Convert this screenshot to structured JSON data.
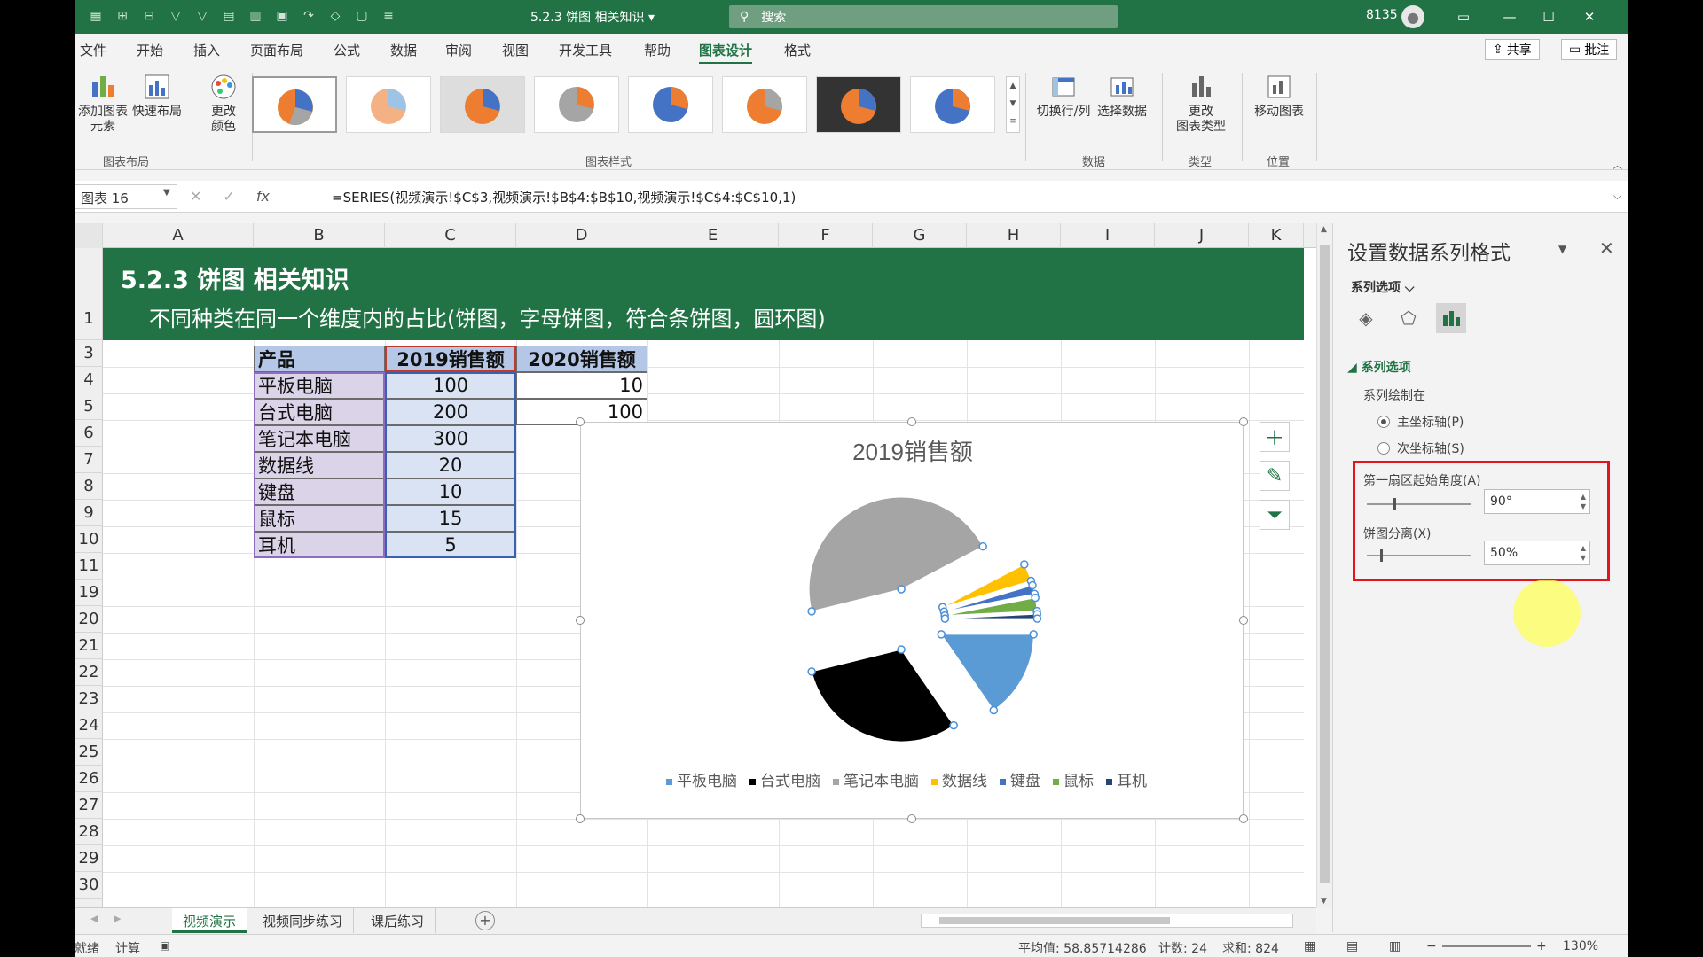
{
  "titlebar": {
    "doc_title": "5.2.3 饼图    相关知识 ▾",
    "search_placeholder": "搜索",
    "user_id": "8135",
    "minimize": "—",
    "restore": "☐",
    "close": "✕"
  },
  "menu": {
    "tabs": [
      "文件",
      "开始",
      "插入",
      "页面布局",
      "公式",
      "数据",
      "审阅",
      "视图",
      "开发工具",
      "帮助",
      "图表设计",
      "格式"
    ],
    "active": "图表设计",
    "share": "共享",
    "comment": "批注"
  },
  "ribbon": {
    "add_element": "添加图表\n元素",
    "quick_layout": "快速布局",
    "change_color": "更改\n颜色",
    "group_layout": "图表布局",
    "group_styles": "图表样式",
    "switch_row_col": "切换行/列",
    "select_data": "选择数据",
    "group_data": "数据",
    "change_type": "更改\n图表类型",
    "group_type": "类型",
    "move_chart": "移动图表",
    "group_location": "位置"
  },
  "formula_bar": {
    "name_box": "图表 16",
    "formula": "=SERIES(视频演示!$C$3,视频演示!$B$4:$B$10,视频演示!$C$4:$C$10,1)"
  },
  "columns": [
    "A",
    "B",
    "C",
    "D",
    "E",
    "F",
    "G",
    "H",
    "I",
    "J",
    "K"
  ],
  "rows": [
    "1",
    "3",
    "4",
    "5",
    "6",
    "7",
    "8",
    "9",
    "10",
    "11",
    "19",
    "20",
    "21",
    "22",
    "23",
    "24",
    "25",
    "26",
    "27",
    "28",
    "29",
    "30"
  ],
  "banner": {
    "title": "5.2.3 饼图  相关知识",
    "subtitle": "不同种类在同一个维度内的占比(饼图，字母饼图，符合条饼图，圆环图)"
  },
  "table": {
    "headers": [
      "产品",
      "2019销售额",
      "2020销售额"
    ],
    "rows": [
      [
        "平板电脑",
        "100",
        "10"
      ],
      [
        "台式电脑",
        "200",
        "100"
      ],
      [
        "笔记本电脑",
        "300",
        ""
      ],
      [
        "数据线",
        "20",
        ""
      ],
      [
        "键盘",
        "10",
        ""
      ],
      [
        "鼠标",
        "15",
        ""
      ],
      [
        "耳机",
        "5",
        ""
      ]
    ]
  },
  "chart_data": {
    "type": "pie",
    "title": "2019销售额",
    "categories": [
      "平板电脑",
      "台式电脑",
      "笔记本电脑",
      "数据线",
      "键盘",
      "鼠标",
      "耳机"
    ],
    "values": [
      100,
      200,
      300,
      20,
      10,
      15,
      5
    ],
    "colors": [
      "#5b9bd5",
      "#000000",
      "#a5a5a5",
      "#ffc000",
      "#4472c4",
      "#70ad47",
      "#264478"
    ],
    "first_slice_angle_deg": 90,
    "explosion_percent": 50,
    "legend_position": "bottom"
  },
  "format_pane": {
    "title": "设置数据系列格式",
    "series_options_dropdown": "系列选项 ⌵",
    "section": "系列选项",
    "plot_series_on": "系列绘制在",
    "primary_axis": "主坐标轴(P)",
    "secondary_axis": "次坐标轴(S)",
    "angle_label": "第一扇区起始角度(A)",
    "angle_value": "90°",
    "explosion_label": "饼图分离(X)",
    "explosion_value": "50%",
    "angle_fraction": 0.25,
    "explosion_fraction": 0.125
  },
  "sheets": {
    "tabs": [
      "视频演示",
      "视频同步练习",
      "课后练习"
    ],
    "active": "视频演示"
  },
  "status": {
    "ready": "就绪",
    "calc": "计算",
    "average": "平均值: 58.85714286",
    "count": "计数: 24",
    "sum": "求和: 824",
    "zoom": "130%"
  },
  "colors": {
    "excel_green": "#217346",
    "highlight_red": "#e3141b"
  }
}
